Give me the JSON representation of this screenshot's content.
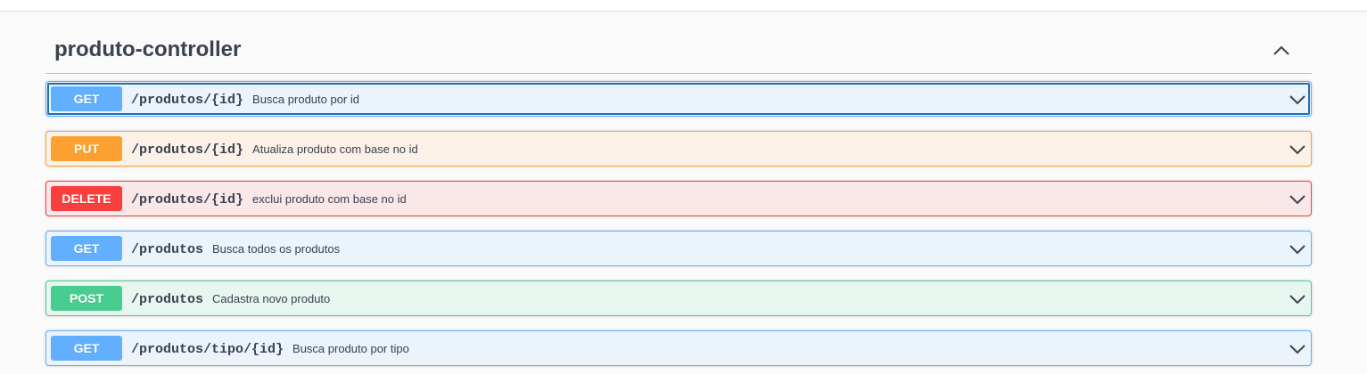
{
  "section": {
    "title": "produto-controller",
    "expanded": true
  },
  "operations": [
    {
      "method": "GET",
      "path": "/produtos/{id}",
      "summary": "Busca produto por id",
      "color": "#61affe",
      "focused": true
    },
    {
      "method": "PUT",
      "path": "/produtos/{id}",
      "summary": "Atualiza produto com base no id",
      "color": "#fca130"
    },
    {
      "method": "DELETE",
      "path": "/produtos/{id}",
      "summary": "exclui produto com base no id",
      "color": "#f93e3e"
    },
    {
      "method": "GET",
      "path": "/produtos",
      "summary": "Busca todos os produtos",
      "color": "#61affe"
    },
    {
      "method": "POST",
      "path": "/produtos",
      "summary": "Cadastra novo produto",
      "color": "#49cc90"
    },
    {
      "method": "GET",
      "path": "/produtos/tipo/{id}",
      "summary": "Busca produto por tipo",
      "color": "#61affe"
    }
  ],
  "icons": {
    "section_toggle": "chevron-up-icon",
    "operation_toggle": "chevron-down-icon"
  }
}
